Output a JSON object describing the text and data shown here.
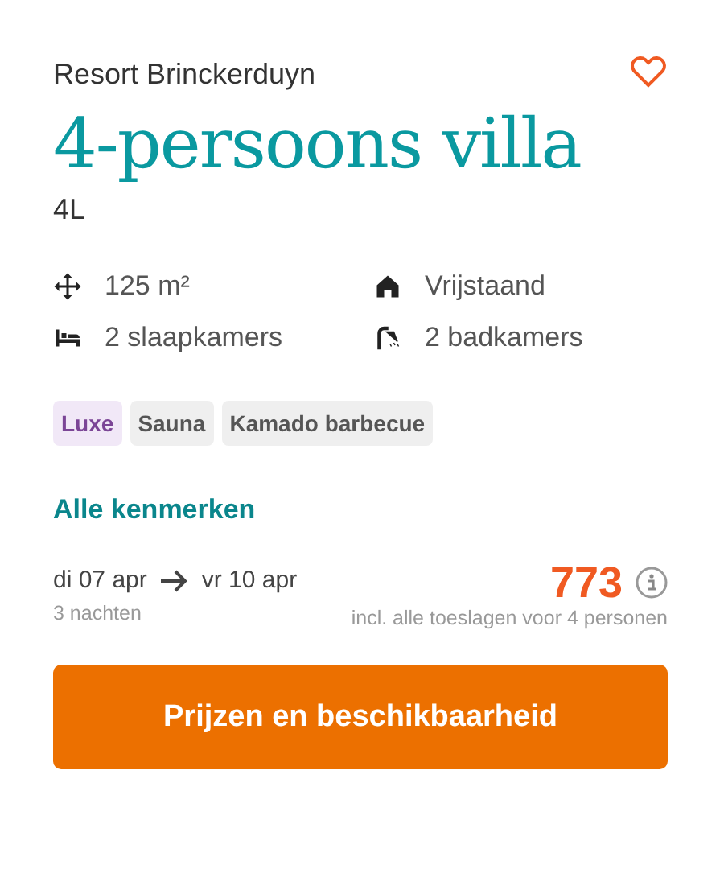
{
  "park": "Resort Brinckerduyn",
  "favorite": false,
  "title": "4-persoons villa",
  "code": "4L",
  "features": [
    {
      "kind": "area",
      "label": "125 m²"
    },
    {
      "kind": "house",
      "label": "Vrijstaand"
    },
    {
      "kind": "bed",
      "label": "2 slaapkamers"
    },
    {
      "kind": "shower",
      "label": "2 badkamers"
    }
  ],
  "tags": [
    {
      "kind": "highlight",
      "label": "Luxe"
    },
    {
      "kind": "plain",
      "label": "Sauna"
    },
    {
      "kind": "plain",
      "label": "Kamado barbecue"
    }
  ],
  "all_features_link": "Alle kenmerken",
  "arrival": "di 07 apr",
  "departure": "vr 10 apr",
  "nights": "3 nachten",
  "price": "773",
  "price_note": "incl. alle toeslagen voor 4 personen",
  "button": "Prijzen en beschikbaarheid"
}
